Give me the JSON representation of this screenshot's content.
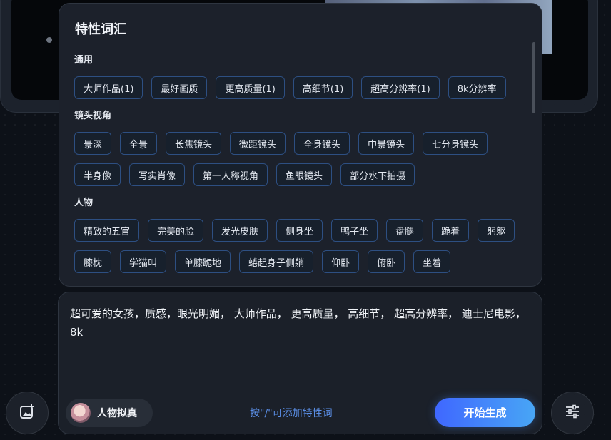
{
  "panel": {
    "title": "特性词汇",
    "sections": [
      {
        "title": "通用",
        "tags": [
          "大师作品(1)",
          "最好画质",
          "更高质量(1)",
          "高细节(1)",
          "超高分辨率(1)",
          "8k分辨率"
        ]
      },
      {
        "title": "镜头视角",
        "tags": [
          "景深",
          "全景",
          "长焦镜头",
          "微距镜头",
          "全身镜头",
          "中景镜头",
          "七分身镜头",
          "半身像",
          "写实肖像",
          "第一人称视角",
          "鱼眼镜头",
          "部分水下拍摄"
        ]
      },
      {
        "title": "人物",
        "tags": [
          "精致的五官",
          "完美的脸",
          "发光皮肤",
          "侧身坐",
          "鸭子坐",
          "盘腿",
          "跪着",
          "躬躯",
          "膝枕",
          "学猫叫",
          "单膝跪地",
          "蜷起身子侧躺",
          "仰卧",
          "俯卧",
          "坐着"
        ]
      }
    ]
  },
  "prompt": {
    "text": "超可爱的女孩，质感，眼光明媚， 大师作品， 更高质量， 高细节， 超高分辨率， 迪士尼电影，8k"
  },
  "footer": {
    "persona_label": "人物拟真",
    "hint": "按\"/\"可添加特性词",
    "generate_label": "开始生成"
  },
  "icons": {
    "left_button": "image-add-icon",
    "right_button": "sliders-icon"
  },
  "colors": {
    "accent_start": "#3f67ff",
    "accent_end": "#48a6f5",
    "hint": "#5b8fe8",
    "tag_border": "#2d4f82"
  }
}
